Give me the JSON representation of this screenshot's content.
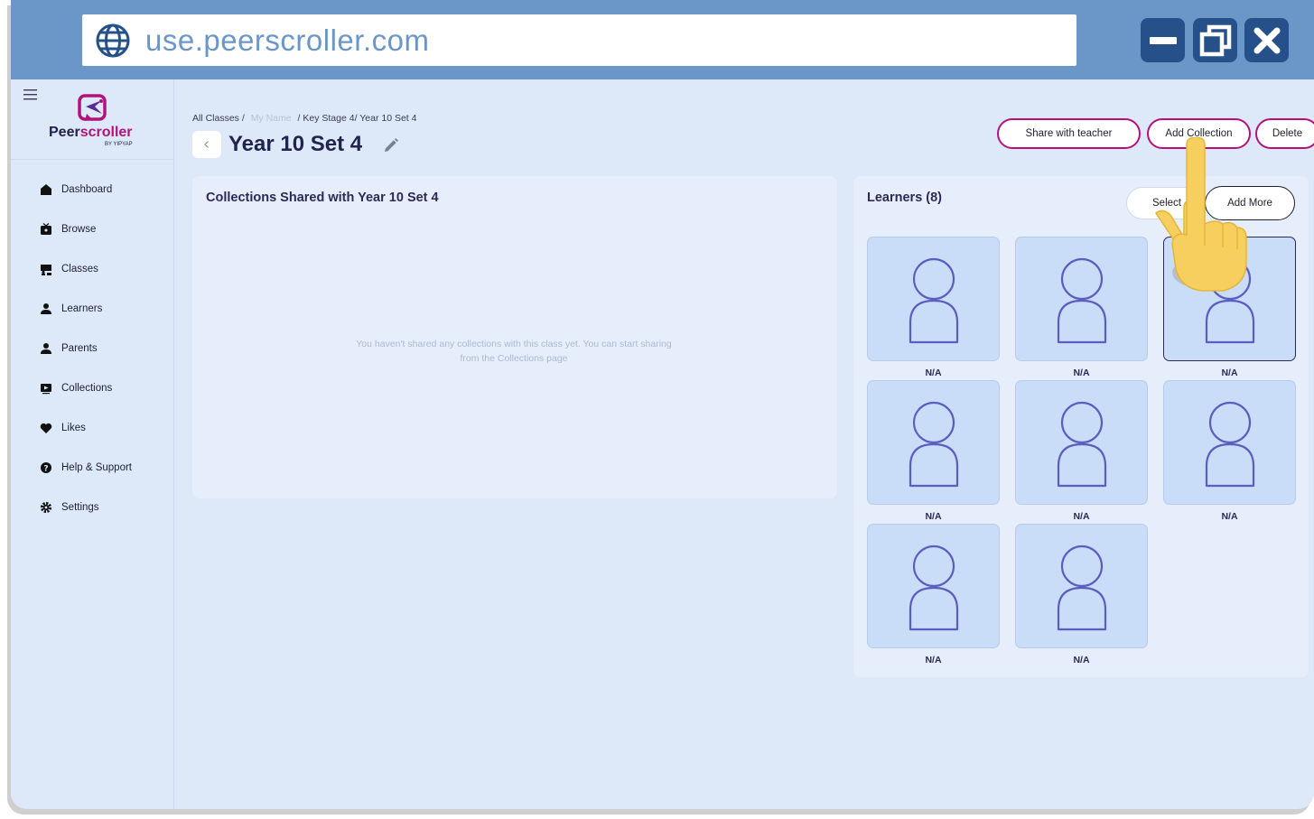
{
  "browser": {
    "url": "use.peerscroller.com",
    "controls": {
      "minimize": "minimize",
      "restore": "restore",
      "close": "close"
    }
  },
  "brand": {
    "name_part1": "Peer",
    "name_part2": "scroller",
    "sub": "BY YIPYAP",
    "accent_color": "#b3127e"
  },
  "sidebar": {
    "items": [
      {
        "label": "Dashboard",
        "icon": "home-icon"
      },
      {
        "label": "Browse",
        "icon": "tv-icon"
      },
      {
        "label": "Classes",
        "icon": "classes-icon"
      },
      {
        "label": "Learners",
        "icon": "user-icon"
      },
      {
        "label": "Parents",
        "icon": "user-icon"
      },
      {
        "label": "Collections",
        "icon": "collection-icon"
      },
      {
        "label": "Likes",
        "icon": "heart-icon"
      },
      {
        "label": "Help & Support",
        "icon": "help-icon"
      },
      {
        "label": "Settings",
        "icon": "gear-icon"
      }
    ]
  },
  "breadcrumb": {
    "all_classes": "All Classes /",
    "name": "My Name",
    "rest": "/ Key Stage 4/ Year 10 Set 4"
  },
  "page": {
    "title": "Year 10 Set 4"
  },
  "actions": {
    "share": "Share with teacher",
    "add_collection": "Add Collection",
    "delete": "Delete"
  },
  "collections": {
    "title": "Collections Shared with Year 10 Set 4",
    "empty": "You haven't shared any collections with this class yet. You can start sharing from the Collections page"
  },
  "learners": {
    "title": "Learners (8)",
    "select": "Select",
    "add_more": "Add More",
    "items": [
      {
        "label": "N/A"
      },
      {
        "label": "N/A"
      },
      {
        "label": "N/A"
      },
      {
        "label": "N/A"
      },
      {
        "label": "N/A"
      },
      {
        "label": "N/A"
      },
      {
        "label": "N/A"
      },
      {
        "label": "N/A"
      }
    ]
  }
}
